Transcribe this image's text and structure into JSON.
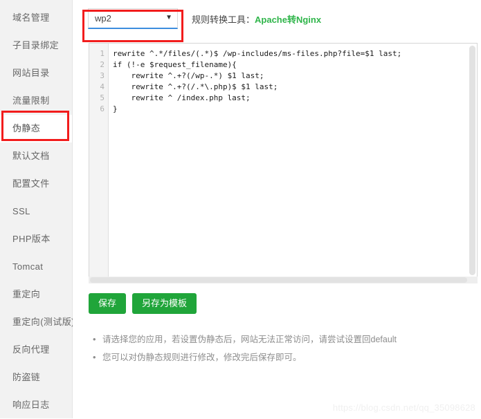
{
  "sidebar": {
    "items": [
      {
        "label": "域名管理",
        "active": false
      },
      {
        "label": "子目录绑定",
        "active": false
      },
      {
        "label": "网站目录",
        "active": false
      },
      {
        "label": "流量限制",
        "active": false
      },
      {
        "label": "伪静态",
        "active": true
      },
      {
        "label": "默认文档",
        "active": false
      },
      {
        "label": "配置文件",
        "active": false
      },
      {
        "label": "SSL",
        "active": false
      },
      {
        "label": "PHP版本",
        "active": false
      },
      {
        "label": "Tomcat",
        "active": false
      },
      {
        "label": "重定向",
        "active": false
      },
      {
        "label": "重定向(测试版)",
        "active": false
      },
      {
        "label": "反向代理",
        "active": false
      },
      {
        "label": "防盗链",
        "active": false
      },
      {
        "label": "响应日志",
        "active": false
      }
    ]
  },
  "toolbar": {
    "select_value": "wp2",
    "select_options": [
      "wp2"
    ],
    "caret_icon": "chevron-down-icon",
    "tool_label": "规则转换工具：",
    "tool_link": "Apache转Nginx",
    "link_color": "#2fb54a"
  },
  "editor": {
    "line_numbers": [
      "1",
      "2",
      "3",
      "4",
      "5",
      "6"
    ],
    "lines": [
      "rewrite ^.*/files/(.*)$ /wp-includes/ms-files.php?file=$1 last;",
      "if (!-e $request_filename){",
      "    rewrite ^.+?(/wp-.*) $1 last;",
      "    rewrite ^.+?(/.*\\.php)$ $1 last;",
      "    rewrite ^ /index.php last;",
      "}"
    ]
  },
  "buttons": {
    "save": "保存",
    "save_as_template": "另存为模板",
    "accent_color": "#20a53a"
  },
  "notes": [
    "请选择您的应用，若设置伪静态后，网站无法正常访问，请尝试设置回default",
    "您可以对伪静态规则进行修改，修改完后保存即可。"
  ],
  "watermark": "https://blog.csdn.net/qq_35098628",
  "annotations": {
    "highlight_color": "#f21c1c",
    "select_box": "red-rectangle-around-app-select",
    "sidebar_box": "red-rectangle-around-pseudo-static-item"
  }
}
